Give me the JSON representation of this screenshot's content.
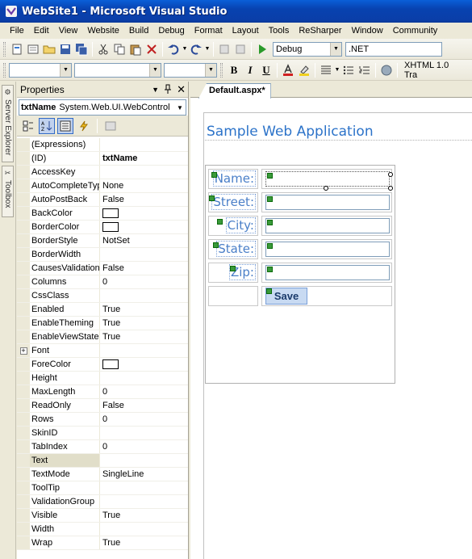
{
  "window": {
    "title": "WebSite1 - Microsoft Visual Studio"
  },
  "menu": [
    "File",
    "Edit",
    "View",
    "Website",
    "Build",
    "Debug",
    "Format",
    "Layout",
    "Tools",
    "ReSharper",
    "Window",
    "Community"
  ],
  "toolbar": {
    "config_combo": "Debug",
    "platform_combo": ".NET",
    "doctype_combo": "XHTML 1.0 Tra"
  },
  "side_tabs": [
    "Server Explorer",
    "Toolbox"
  ],
  "properties": {
    "header": "Properties",
    "object_name": "txtName",
    "object_type": "System.Web.UI.WebControl",
    "rows": [
      {
        "name": "(Expressions)",
        "value": ""
      },
      {
        "name": "(ID)",
        "value": "txtName",
        "bold": true
      },
      {
        "name": "AccessKey",
        "value": ""
      },
      {
        "name": "AutoCompleteType",
        "value": "None"
      },
      {
        "name": "AutoPostBack",
        "value": "False"
      },
      {
        "name": "BackColor",
        "value": "",
        "color": true
      },
      {
        "name": "BorderColor",
        "value": "",
        "color": true
      },
      {
        "name": "BorderStyle",
        "value": "NotSet"
      },
      {
        "name": "BorderWidth",
        "value": ""
      },
      {
        "name": "CausesValidation",
        "value": "False"
      },
      {
        "name": "Columns",
        "value": "0"
      },
      {
        "name": "CssClass",
        "value": ""
      },
      {
        "name": "Enabled",
        "value": "True"
      },
      {
        "name": "EnableTheming",
        "value": "True"
      },
      {
        "name": "EnableViewState",
        "value": "True"
      },
      {
        "name": "Font",
        "value": "",
        "expander": true
      },
      {
        "name": "ForeColor",
        "value": "",
        "color": true
      },
      {
        "name": "Height",
        "value": ""
      },
      {
        "name": "MaxLength",
        "value": "0"
      },
      {
        "name": "ReadOnly",
        "value": "False"
      },
      {
        "name": "Rows",
        "value": "0"
      },
      {
        "name": "SkinID",
        "value": ""
      },
      {
        "name": "TabIndex",
        "value": "0"
      },
      {
        "name": "Text",
        "value": "",
        "selected": true
      },
      {
        "name": "TextMode",
        "value": "SingleLine"
      },
      {
        "name": "ToolTip",
        "value": ""
      },
      {
        "name": "ValidationGroup",
        "value": ""
      },
      {
        "name": "Visible",
        "value": "True"
      },
      {
        "name": "Width",
        "value": ""
      },
      {
        "name": "Wrap",
        "value": "True"
      }
    ]
  },
  "editor": {
    "tab_label": "Default.aspx*",
    "page_title": "Sample Web Application",
    "form": {
      "labels": [
        "Name:",
        "Street:",
        "City:",
        "State:",
        "Zip:"
      ],
      "save_label": "Save"
    }
  }
}
